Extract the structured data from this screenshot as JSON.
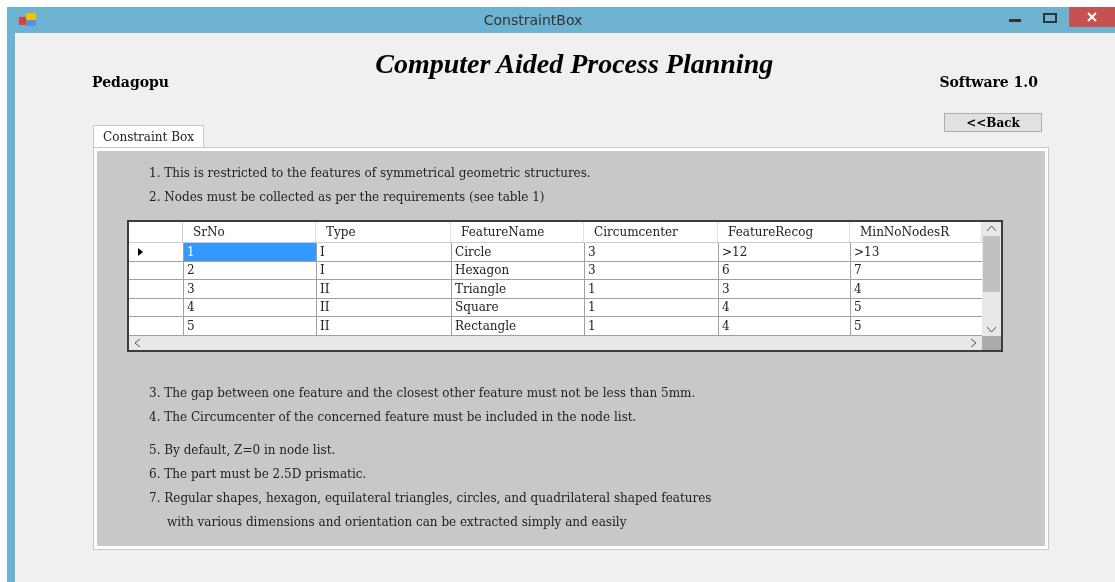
{
  "window": {
    "title": "ConstraintBox"
  },
  "header": {
    "title": "Computer Aided Process Planning",
    "author": "Pedagopu",
    "version": "Software 1.0",
    "back_button": "<<Back"
  },
  "tabs": [
    {
      "label": "Constraint Box",
      "selected": true
    }
  ],
  "notes_before": [
    "1. This is restricted to the features of symmetrical geometric structures.",
    "2. Nodes must be collected as per the requirements (see table 1)"
  ],
  "table": {
    "columns": [
      "SrNo",
      "Type",
      "FeatureName",
      "Circumcenter",
      "FeatureRecog",
      "MinNoNodesR"
    ],
    "rows": [
      {
        "selected": true,
        "cells": [
          "1",
          "I",
          "Circle",
          "3",
          ">12",
          ">13"
        ]
      },
      {
        "selected": false,
        "cells": [
          "2",
          "I",
          "Hexagon",
          "3",
          "6",
          "7"
        ]
      },
      {
        "selected": false,
        "cells": [
          "3",
          "II",
          "Triangle",
          "1",
          "3",
          "4"
        ]
      },
      {
        "selected": false,
        "cells": [
          "4",
          "II",
          "Square",
          "1",
          "4",
          "5"
        ]
      },
      {
        "selected": false,
        "cells": [
          "5",
          "II",
          "Rectangle",
          "1",
          "4",
          "5"
        ]
      }
    ]
  },
  "notes_after": [
    "3. The gap between one feature and the closest other feature must not be less than 5mm.",
    "4. The Circumcenter of the concerned feature must be included in the node list.",
    "5. By default, Z=0 in node list.",
    "6. The part must be 2.5D prismatic.",
    "7. Regular shapes, hexagon, equilateral triangles, circles, and quadrilateral shaped features",
    "with various dimensions and orientation can be extracted simply and easily"
  ]
}
